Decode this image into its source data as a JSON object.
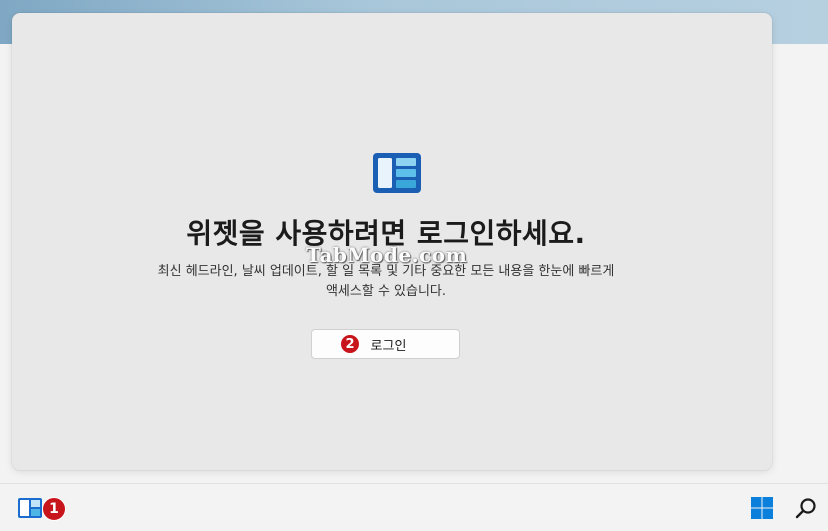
{
  "widgets_panel": {
    "title": "위젯을 사용하려면 로그인하세요.",
    "description_line1": "최신 헤드라인, 날씨 업데이트, 할 일 목록 및 기타 중요한 모든 내용을 한눈에 빠르게",
    "description_line2": "액세스할 수 있습니다.",
    "login_button": {
      "label": "로그인",
      "badge": "2"
    }
  },
  "watermark": "TabMode.com",
  "taskbar": {
    "widgets_badge": "1",
    "icons": [
      "widgets-icon",
      "windows-start-icon",
      "search-icon"
    ]
  },
  "colors": {
    "panel_bg": "#e8e8e8",
    "badge_red": "#c8151b",
    "taskbar_bg": "#f3f3f3",
    "widgets_blue": "#1a6dcf",
    "start_blue": "#0a7fdc"
  }
}
